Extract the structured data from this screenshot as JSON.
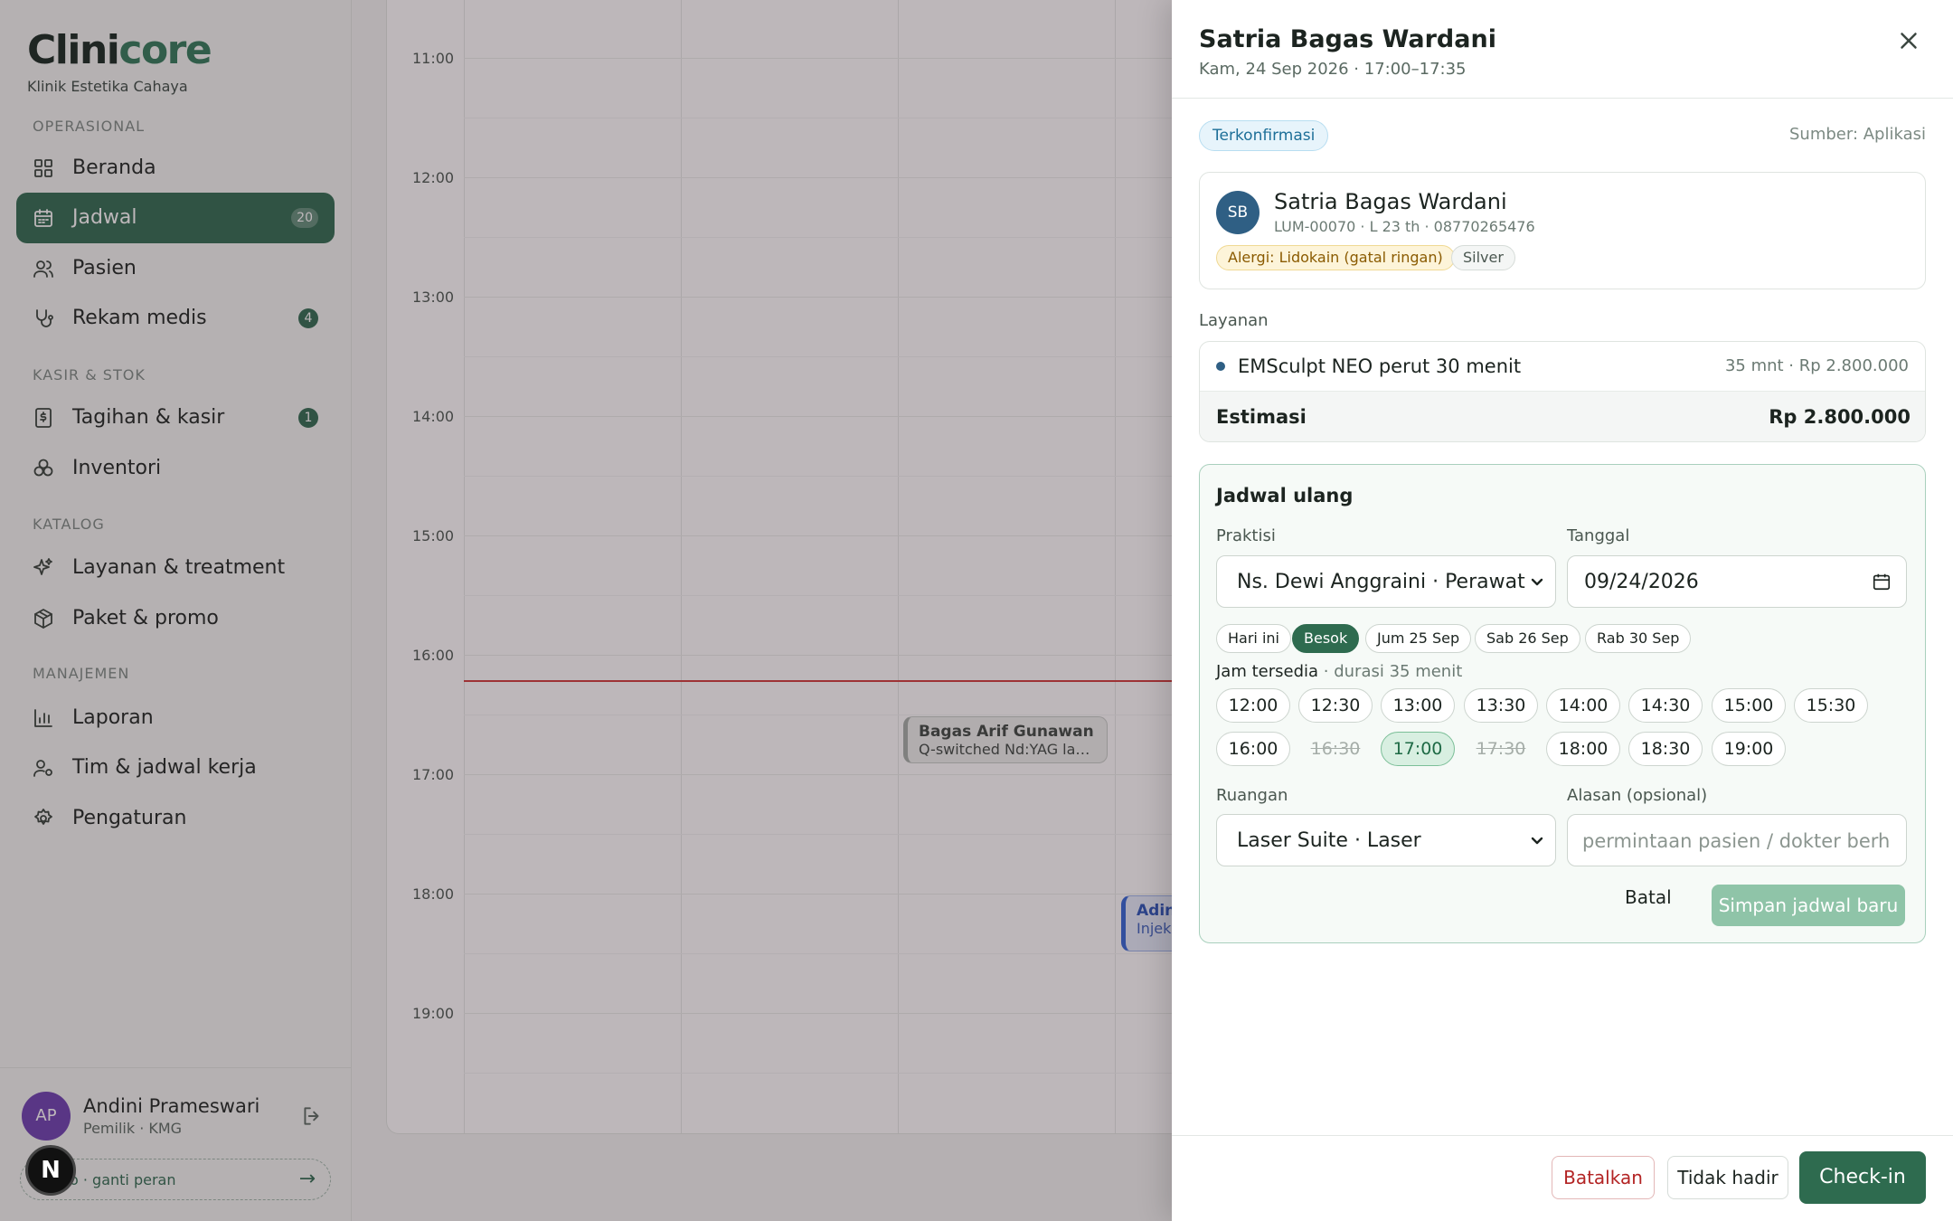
{
  "app": {
    "logo_part1": "Clini",
    "logo_part2": "core",
    "clinic_name": "Klinik Estetika Cahaya"
  },
  "colors": {
    "brand": "#2e6b4f",
    "brand_light": "#8fc4a8",
    "danger": "#b32424",
    "now_line": "#d13b3b",
    "avatar_user": "#6b3fb1",
    "avatar_patient": "#2f5f84"
  },
  "sidebar": {
    "sections": [
      {
        "label": "OPERASIONAL"
      },
      {
        "label": "KASIR & STOK"
      },
      {
        "label": "KATALOG"
      },
      {
        "label": "MANAJEMEN"
      }
    ],
    "items": [
      {
        "label": "Beranda",
        "icon": "grid-icon",
        "badge": ""
      },
      {
        "label": "Jadwal",
        "icon": "calendar-icon",
        "badge": "20",
        "active": true
      },
      {
        "label": "Pasien",
        "icon": "users-icon",
        "badge": ""
      },
      {
        "label": "Rekam medis",
        "icon": "stethoscope-icon",
        "badge": "4"
      },
      {
        "label": "Tagihan & kasir",
        "icon": "receipt-icon",
        "badge": "1"
      },
      {
        "label": "Inventori",
        "icon": "boxes-icon",
        "badge": ""
      },
      {
        "label": "Layanan & treatment",
        "icon": "sparkles-icon",
        "badge": ""
      },
      {
        "label": "Paket & promo",
        "icon": "package-icon",
        "badge": ""
      },
      {
        "label": "Laporan",
        "icon": "bar-chart-icon",
        "badge": ""
      },
      {
        "label": "Tim & jadwal kerja",
        "icon": "user-cog-icon",
        "badge": ""
      },
      {
        "label": "Pengaturan",
        "icon": "gear-icon",
        "badge": ""
      }
    ]
  },
  "user": {
    "initials": "AP",
    "name": "Andini Prameswari",
    "role": "Pemilik · KMG",
    "switch_label": "o · ganti peran",
    "switch_arrow": "→",
    "n_badge": "N"
  },
  "calendar": {
    "times": [
      "11:00",
      "12:00",
      "13:00",
      "14:00",
      "15:00",
      "16:00",
      "17:00",
      "18:00",
      "19:00"
    ],
    "appointments": [
      {
        "name": "Bagas Arif Gunawan",
        "treatment": "Q-switched Nd:YAG las..."
      },
      {
        "name": "Adin",
        "treatment": "Injeks"
      }
    ]
  },
  "drawer": {
    "title": "Satria Bagas Wardani",
    "subtitle": "Kam, 24 Sep 2026 · 17:00–17:35",
    "status": "Terkonfirmasi",
    "source": "Sumber: Aplikasi",
    "patient": {
      "initials": "SB",
      "name": "Satria Bagas Wardani",
      "meta": "LUM-00070 · L 23 th · 08770265476",
      "allergy": "Alergi: Lidokain (gatal ringan)",
      "tier": "Silver"
    },
    "service_label": "Layanan",
    "service": {
      "name": "EMSculpt NEO perut 30 menit",
      "price": "35 mnt · Rp 2.800.000",
      "estimate_label": "Estimasi",
      "estimate_value": "Rp 2.800.000"
    },
    "reschedule": {
      "title": "Jadwal ulang",
      "practitioner_label": "Praktisi",
      "practitioner_value": "Ns. Dewi Anggraini · Perawat",
      "date_label": "Tanggal",
      "date_value": "09/24/2026",
      "day_chips": [
        {
          "label": "Hari ini",
          "selected": false
        },
        {
          "label": "Besok",
          "selected": true
        },
        {
          "label": "Jum 25 Sep",
          "selected": false
        },
        {
          "label": "Sab 26 Sep",
          "selected": false
        },
        {
          "label": "Rab 30 Sep",
          "selected": false
        }
      ],
      "available_label": "Jam tersedia",
      "duration_label": " · durasi 35 menit",
      "slots": [
        {
          "time": "12:00",
          "state": "available"
        },
        {
          "time": "12:30",
          "state": "available"
        },
        {
          "time": "13:00",
          "state": "available"
        },
        {
          "time": "13:30",
          "state": "available"
        },
        {
          "time": "14:00",
          "state": "available"
        },
        {
          "time": "14:30",
          "state": "available"
        },
        {
          "time": "15:00",
          "state": "available"
        },
        {
          "time": "15:30",
          "state": "available"
        },
        {
          "time": "16:00",
          "state": "available"
        },
        {
          "time": "16:30",
          "state": "disabled"
        },
        {
          "time": "17:00",
          "state": "selected"
        },
        {
          "time": "17:30",
          "state": "disabled"
        },
        {
          "time": "18:00",
          "state": "available"
        },
        {
          "time": "18:30",
          "state": "available"
        },
        {
          "time": "19:00",
          "state": "available"
        }
      ],
      "room_label": "Ruangan",
      "room_value": "Laser Suite · Laser",
      "reason_label": "Alasan (opsional)",
      "reason_placeholder": "permintaan pasien / dokter berhala",
      "cancel_label": "Batal",
      "save_label": "Simpan jadwal baru"
    },
    "footer": {
      "cancel_label": "Batalkan",
      "noshow_label": "Tidak hadir",
      "checkin_label": "Check-in"
    }
  }
}
